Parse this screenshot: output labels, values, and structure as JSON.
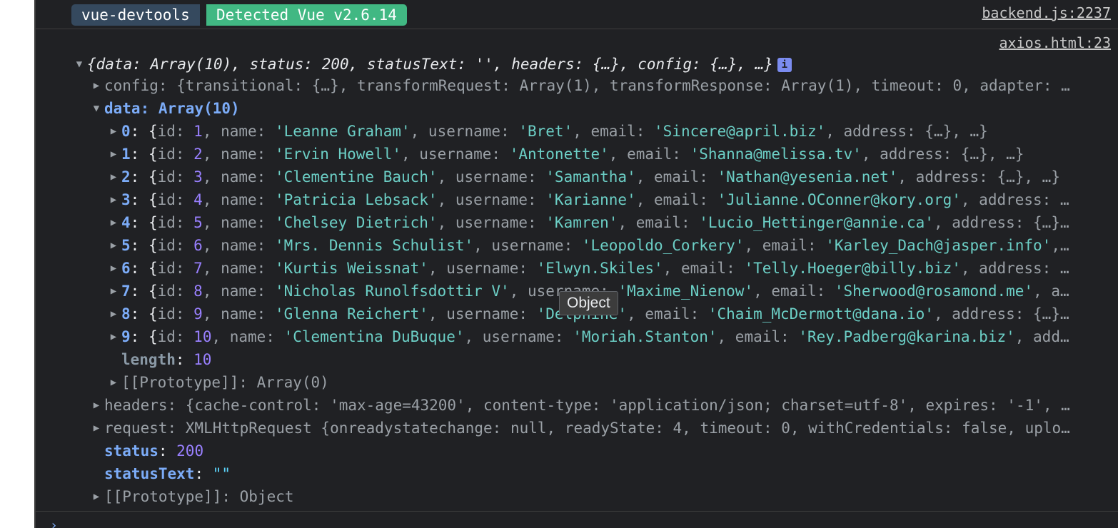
{
  "header": {
    "badge_left": "vue-devtools",
    "badge_right": "Detected Vue v2.6.14",
    "source_link": "backend.js:2237"
  },
  "log": {
    "source_link": "axios.html:23",
    "summary": "{data: Array(10), status: 200, statusText: '', headers: {…}, config: {…}, …}",
    "info_icon": "i",
    "config_line": "config: {transitional: {…}, transformRequest: Array(1), transformResponse: Array(1), timeout: 0, adapter: …",
    "data_label": "data: Array(10)",
    "items": [
      {
        "idx": "0",
        "id": "1",
        "name": "'Leanne Graham'",
        "username": "'Bret'",
        "email": "'Sincere@april.biz'",
        "tail": ", address: {…}, …}"
      },
      {
        "idx": "1",
        "id": "2",
        "name": "'Ervin Howell'",
        "username": "'Antonette'",
        "email": "'Shanna@melissa.tv'",
        "tail": ", address: {…}, …}"
      },
      {
        "idx": "2",
        "id": "3",
        "name": "'Clementine Bauch'",
        "username": "'Samantha'",
        "email": "'Nathan@yesenia.net'",
        "tail": ", address: {…}, …}"
      },
      {
        "idx": "3",
        "id": "4",
        "name": "'Patricia Lebsack'",
        "username": "'Karianne'",
        "email": "'Julianne.OConner@kory.org'",
        "tail": ", address: …"
      },
      {
        "idx": "4",
        "id": "5",
        "name": "'Chelsey Dietrich'",
        "username": "'Kamren'",
        "email": "'Lucio_Hettinger@annie.ca'",
        "tail": ", address: {…}…"
      },
      {
        "idx": "5",
        "id": "6",
        "name": "'Mrs. Dennis Schulist'",
        "username": "'Leopoldo_Corkery'",
        "email": "'Karley_Dach@jasper.info'",
        "tail": ",…"
      },
      {
        "idx": "6",
        "id": "7",
        "name": "'Kurtis Weissnat'",
        "username": "'Elwyn.Skiles'",
        "email": "'Telly.Hoeger@billy.biz'",
        "tail": ", address: …"
      },
      {
        "idx": "7",
        "id": "8",
        "name": "'Nicholas Runolfsdottir V'",
        "username": "'Maxime_Nienow'",
        "email": "'Sherwood@rosamond.me'",
        "tail": ", a…"
      },
      {
        "idx": "8",
        "id": "9",
        "name": "'Glenna Reichert'",
        "username": "'Delphine'",
        "email": "'Chaim_McDermott@dana.io'",
        "tail": ", address: {…}…"
      },
      {
        "idx": "9",
        "id": "10",
        "name": "'Clementina DuBuque'",
        "username": "'Moriah.Stanton'",
        "email": "'Rey.Padberg@karina.biz'",
        "tail": ", add…"
      }
    ],
    "length_key": "length",
    "length_val": "10",
    "array_proto": "[[Prototype]]: Array(0)",
    "headers_line": "headers: {cache-control: 'max-age=43200', content-type: 'application/json; charset=utf-8', expires: '-1', …",
    "request_line": "request: XMLHttpRequest {onreadystatechange: null, readyState: 4, timeout: 0, withCredentials: false, uplo…",
    "status_key": "status",
    "status_val": "200",
    "statustext_key": "statusText",
    "statustext_val": "\"\"",
    "obj_proto": "[[Prototype]]: Object"
  },
  "tooltip": "Object",
  "prompt": "›"
}
